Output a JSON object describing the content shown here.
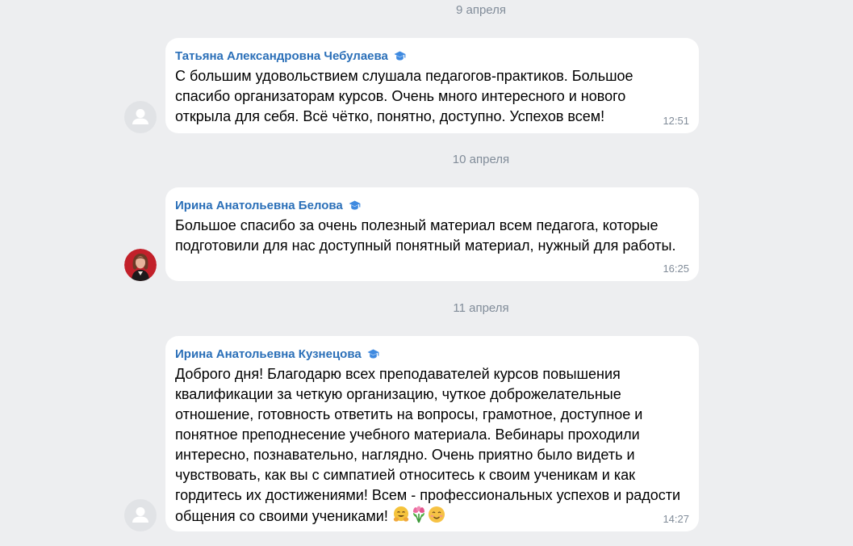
{
  "messages": [
    {
      "date": "9 апреля",
      "author": "Татьяна Александровна Чебулаева",
      "text": "С большим удовольствием слушала педагогов-практиков. Большое\nспасибо организаторам курсов. Очень много интересного и нового\nоткрыла для себя. Всё чётко, понятно, доступно. Успехов всем!",
      "time": "12:51",
      "avatar": "placeholder"
    },
    {
      "date": "10 апреля",
      "author": "Ирина Анатольевна Белова",
      "text": "Большое спасибо за очень полезный материал всем педагога, которые\nподготовили для нас доступный понятный материал, нужный для работы.",
      "time": "16:25",
      "avatar": "photo"
    },
    {
      "date": "11 апреля",
      "author": "Ирина Анатольевна Кузнецова",
      "text": "Доброго дня! Благодарю всех преподавателей курсов повышения\nквалификации за четкую организацию, чуткое доброжелательные\nотношение, готовность ответить на вопросы, грамотное, доступное и\nпонятное преподнесение учебного материала. Вебинары проходили\nинтересно, познавательно, наглядно. Очень приятно было видеть и\nчувствовать, как вы с симпатией относитесь к своим ученикам и как\nгордитесь их достижениями! Всем - профессиональных успехов и радости\nобщения со своими учениками! ",
      "emojis": [
        "hugging-face-emoji",
        "tulip-bouquet-emoji",
        "smiling-face-emoji"
      ],
      "time": "14:27",
      "avatar": "placeholder"
    }
  ],
  "icons": {
    "verified": "graduation-cap-icon",
    "avatar_placeholder": "user-silhouette-icon"
  },
  "colors": {
    "background": "#edeef0",
    "bubble": "#ffffff",
    "author": "#2a6fb8",
    "meta": "#818c99",
    "cap_icon": "#3f8ae0"
  }
}
